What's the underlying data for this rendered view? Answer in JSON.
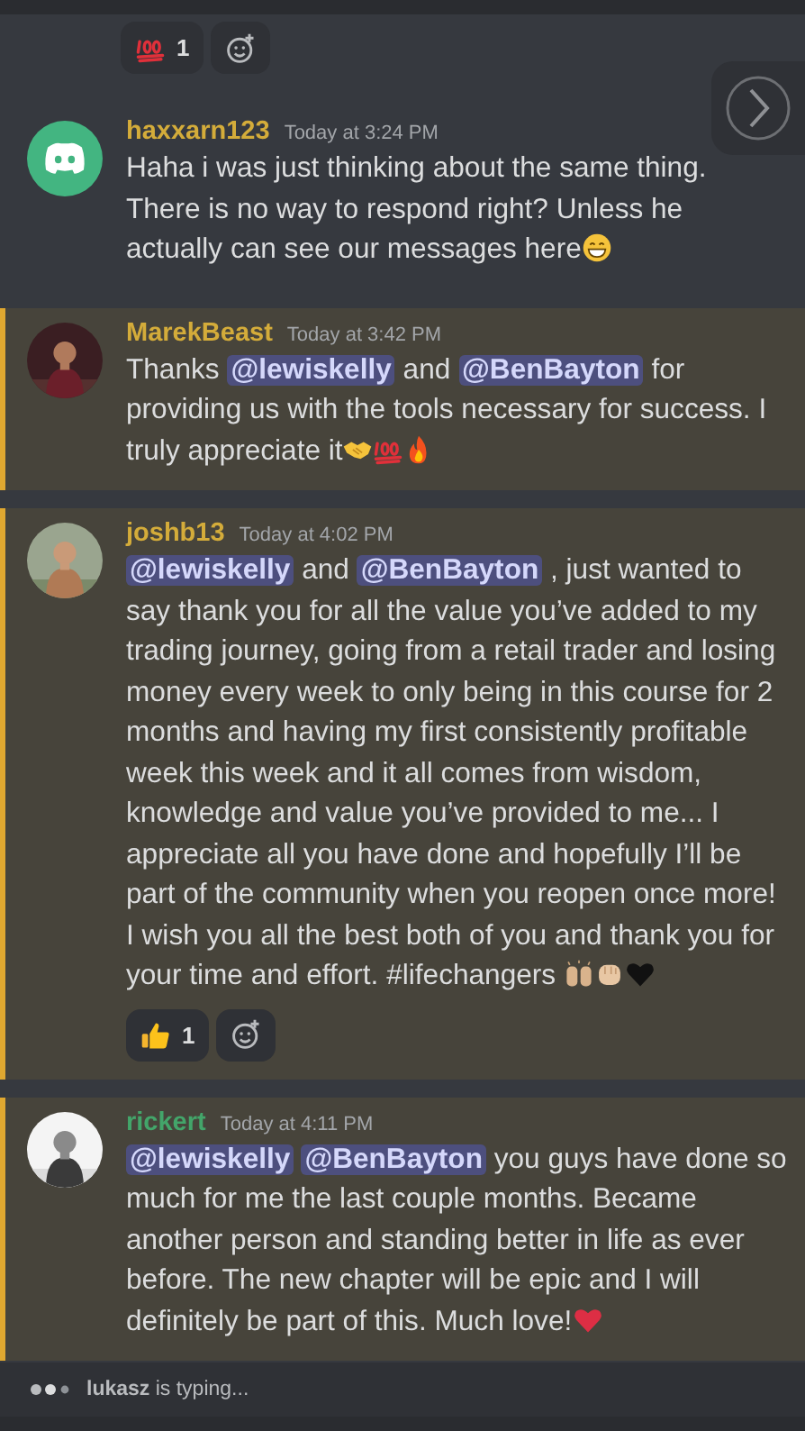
{
  "top_reactions": [
    {
      "kind": "hundred",
      "count": "1"
    }
  ],
  "messages": [
    {
      "author": "haxxarn123",
      "color": "#d4ac3a",
      "avatar": {
        "kind": "logo"
      },
      "time": "Today at 3:24 PM",
      "highlighted": false,
      "content": [
        {
          "kind": "text",
          "text": "Haha i was just thinking about the same thing. There is no way to respond right? Unless he actually can see our messages here"
        },
        {
          "kind": "grin"
        }
      ]
    },
    {
      "author": "MarekBeast",
      "color": "#d4ac3a",
      "avatar": {
        "kind": "picture"
      },
      "time": "Today at 3:42 PM",
      "highlighted": true,
      "content": [
        {
          "kind": "text",
          "text": "Thanks "
        },
        {
          "kind": "mention",
          "text": "@lewiskelly"
        },
        {
          "kind": "text",
          "text": " and "
        },
        {
          "kind": "mention",
          "text": "@BenBayton"
        },
        {
          "kind": "text",
          "text": " for providing us with the tools necessary for success. I truly appreciate it"
        },
        {
          "kind": "handshake"
        },
        {
          "kind": "hundred"
        },
        {
          "kind": "fire"
        }
      ]
    },
    {
      "author": "joshb13",
      "color": "#d4ac3a",
      "avatar": {
        "kind": "picture"
      },
      "time": "Today at 4:02 PM",
      "highlighted": true,
      "content": [
        {
          "kind": "mention",
          "text": "@lewiskelly"
        },
        {
          "kind": "text",
          "text": "  and "
        },
        {
          "kind": "mention",
          "text": "@BenBayton"
        },
        {
          "kind": "text",
          "text": " , just wanted to say thank you for all the value you’ve added to my trading journey, going from a retail trader and losing money every week to only being in this course for 2 months and having my first consistently profitable week this week and it all comes from wisdom, knowledge and value you’ve provided to me... I appreciate all you have done and hopefully I’ll be part of the community when you reopen once more! I wish you all the best both of you and thank you for your time and effort. #lifechangers "
        },
        {
          "kind": "raised-hands"
        },
        {
          "kind": "fist"
        },
        {
          "kind": "black-heart"
        }
      ],
      "reactions": [
        {
          "kind": "thumbs-up",
          "count": "1"
        }
      ]
    },
    {
      "author": "rickert",
      "color": "#43a56a",
      "avatar": {
        "kind": "picture"
      },
      "time": "Today at 4:11 PM",
      "highlighted": true,
      "content": [
        {
          "kind": "mention",
          "text": "@lewiskelly"
        },
        {
          "kind": "mention",
          "text": "@BenBayton"
        },
        {
          "kind": "text",
          "text": " you guys have done so much for me the last couple months. Became another person and standing better in life as ever before. The new chapter will be epic and I will definitely be part of this. Much love!"
        },
        {
          "kind": "red-heart"
        }
      ]
    }
  ],
  "typing": {
    "text": "**lukasz** is typing..."
  }
}
